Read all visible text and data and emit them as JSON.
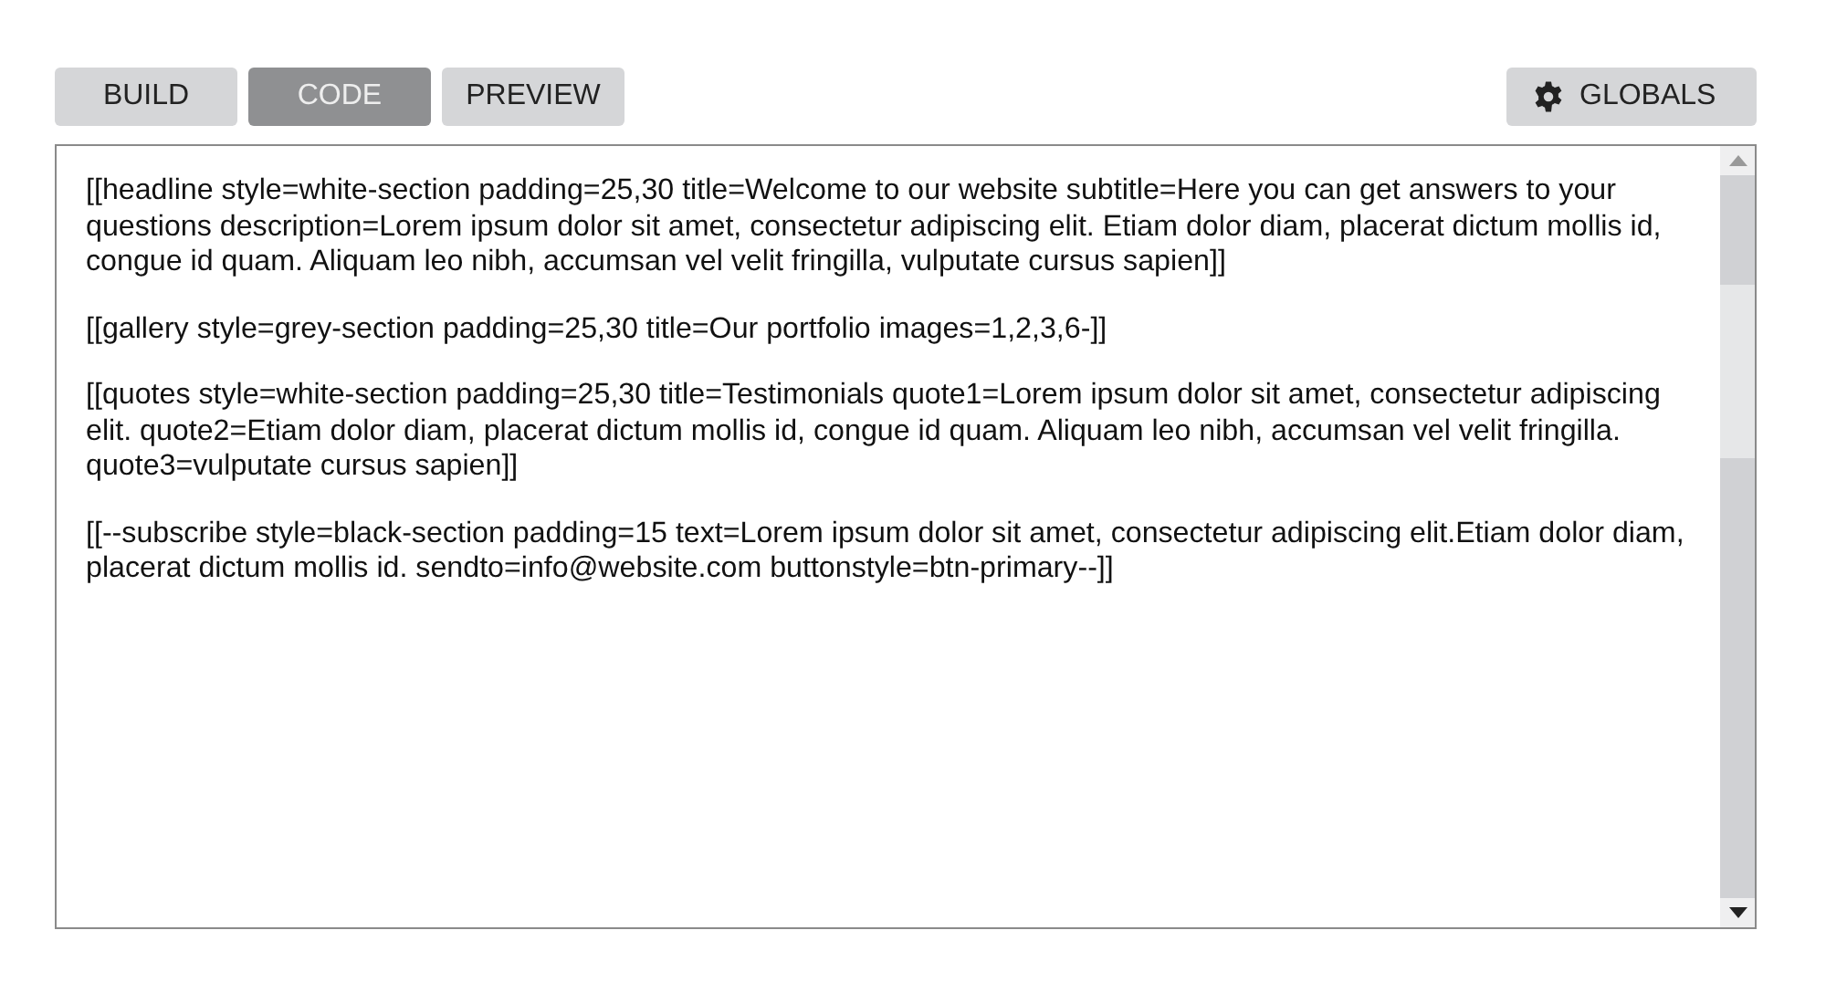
{
  "tabs": [
    {
      "label": "BUILD",
      "selected": false
    },
    {
      "label": "CODE",
      "selected": true
    },
    {
      "label": "PREVIEW",
      "selected": false
    }
  ],
  "globals_button": {
    "label": "GLOBALS"
  },
  "editor": {
    "paragraphs": [
      "[[headline style=white-section padding=25,30 title=Welcome to our website subtitle=Here you can get answers to your questions description=Lorem ipsum dolor sit amet, consectetur adipiscing elit. Etiam dolor diam, placerat dictum mollis id, congue id quam. Aliquam leo nibh, accumsan vel velit fringilla, vulputate cursus sapien]]",
      "[[gallery style=grey-section padding=25,30 title=Our portfolio images=1,2,3,6-]]",
      "[[quotes style=white-section padding=25,30 title=Testimonials quote1=Lorem ipsum dolor sit amet, consectetur adipiscing elit. quote2=Etiam dolor diam, placerat dictum mollis id, congue id quam. Aliquam leo nibh, accumsan vel velit fringilla. quote3=vulputate cursus sapien]]",
      "[[--subscribe style=black-section padding=15 text=Lorem ipsum dolor sit amet, consectetur adipiscing elit.Etiam dolor diam, placerat dictum mollis id. sendto=info@website.com buttonstyle=btn-primary--]]"
    ]
  }
}
